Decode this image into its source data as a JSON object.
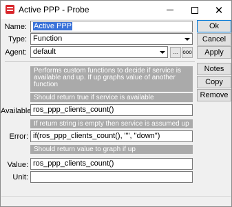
{
  "window": {
    "title": "Active PPP - Probe"
  },
  "form": {
    "name_label": "Name:",
    "name_value": "Active PPP",
    "type_label": "Type:",
    "type_value": "Function",
    "agent_label": "Agent:",
    "agent_value": "default",
    "agent_btn1": "...",
    "agent_btn2": "ooo",
    "description": "Performs custom functions to decide if service is available and up. If up graphs value of another function",
    "available_hint": "Should return true if service is available",
    "available_label": "Available:",
    "available_value": "ros_ppp_clients_count()",
    "error_hint": "If return string is empty then service is assumed up",
    "error_label": "Error:",
    "error_value": "if(ros_ppp_clients_count(), \"\", \"down\")",
    "value_hint": "Should return value to graph if up",
    "value_label": "Value:",
    "value_value": "ros_ppp_clients_count()",
    "unit_label": "Unit:",
    "unit_value": ""
  },
  "buttons": {
    "ok": "Ok",
    "cancel": "Cancel",
    "apply": "Apply",
    "notes": "Notes",
    "copy": "Copy",
    "remove": "Remove"
  }
}
